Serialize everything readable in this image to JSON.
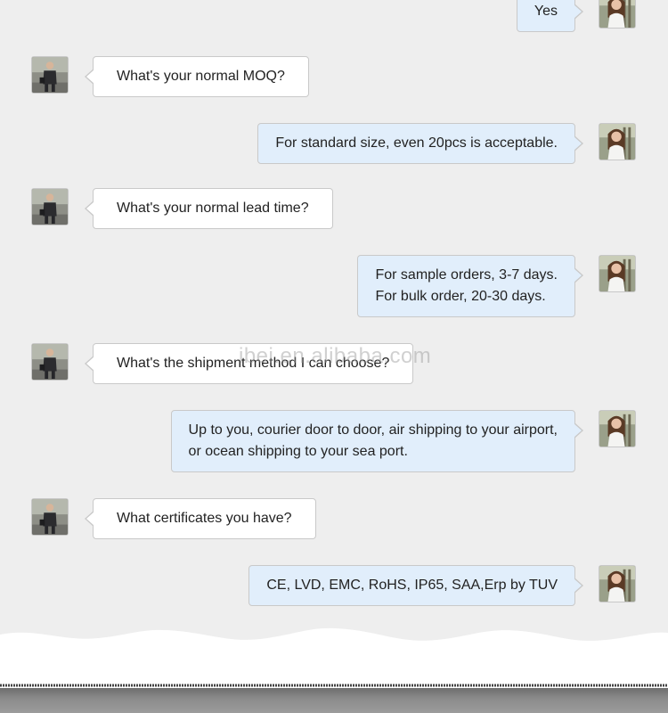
{
  "watermark": "ibei.en.alibaba.com",
  "colors": {
    "background": "#eeeeee",
    "buyer_bubble": "#ffffff",
    "seller_bubble": "#e1eefb",
    "bubble_border": "#c9c9c9"
  },
  "messages": [
    {
      "sender": "seller",
      "avatar": "woman-avatar",
      "lines": [
        "Yes"
      ]
    },
    {
      "sender": "buyer",
      "avatar": "man-avatar",
      "lines": [
        "What's your normal MOQ?"
      ]
    },
    {
      "sender": "seller",
      "avatar": "woman-avatar",
      "lines": [
        "For standard size, even 20pcs is acceptable."
      ]
    },
    {
      "sender": "buyer",
      "avatar": "man-avatar",
      "lines": [
        "What's your normal lead time?"
      ]
    },
    {
      "sender": "seller",
      "avatar": "woman-avatar",
      "lines": [
        "For sample orders, 3-7 days.",
        "For bulk order, 20-30 days."
      ]
    },
    {
      "sender": "buyer",
      "avatar": "man-avatar",
      "lines": [
        "What's the shipment method I can choose?"
      ]
    },
    {
      "sender": "seller",
      "avatar": "woman-avatar",
      "lines": [
        "Up to you, courier door to door, air shipping to your airport,",
        "or ocean shipping to your sea port."
      ]
    },
    {
      "sender": "buyer",
      "avatar": "man-avatar",
      "lines": [
        "What certificates you have?"
      ]
    },
    {
      "sender": "seller",
      "avatar": "woman-avatar",
      "lines": [
        "CE, LVD, EMC, RoHS, IP65, SAA,Erp by TUV"
      ]
    }
  ]
}
